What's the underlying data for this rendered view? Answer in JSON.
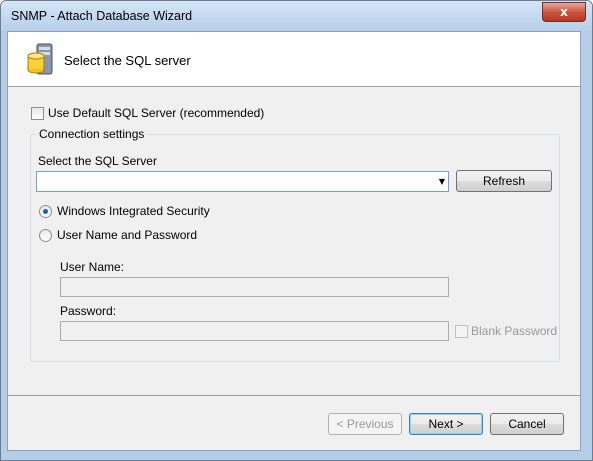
{
  "window": {
    "title": "SNMP - Attach Database Wizard",
    "close_glyph": "x"
  },
  "header": {
    "title": "Select the SQL server",
    "icon": "database-server-icon"
  },
  "use_default": {
    "label": "Use Default SQL Server (recommended)",
    "checked": false
  },
  "connection": {
    "group_title": "Connection settings",
    "server_label": "Select the SQL Server",
    "server_value": "",
    "dropdown_glyph": "▼",
    "refresh_label": "Refresh",
    "auth_options": [
      {
        "label": "Windows Integrated Security",
        "selected": true
      },
      {
        "label": "User Name and Password",
        "selected": false
      }
    ],
    "username_label": "User Name:",
    "username_value": "",
    "password_label": "Password:",
    "password_value": "",
    "blank_password_label": "Blank Password",
    "blank_password_checked": false
  },
  "footer": {
    "previous_label": "< Previous",
    "next_label": "Next >",
    "cancel_label": "Cancel"
  },
  "colors": {
    "titlebar": "#c7dbf1",
    "close_button": "#c9503a",
    "accent": "#1e5fa8"
  }
}
